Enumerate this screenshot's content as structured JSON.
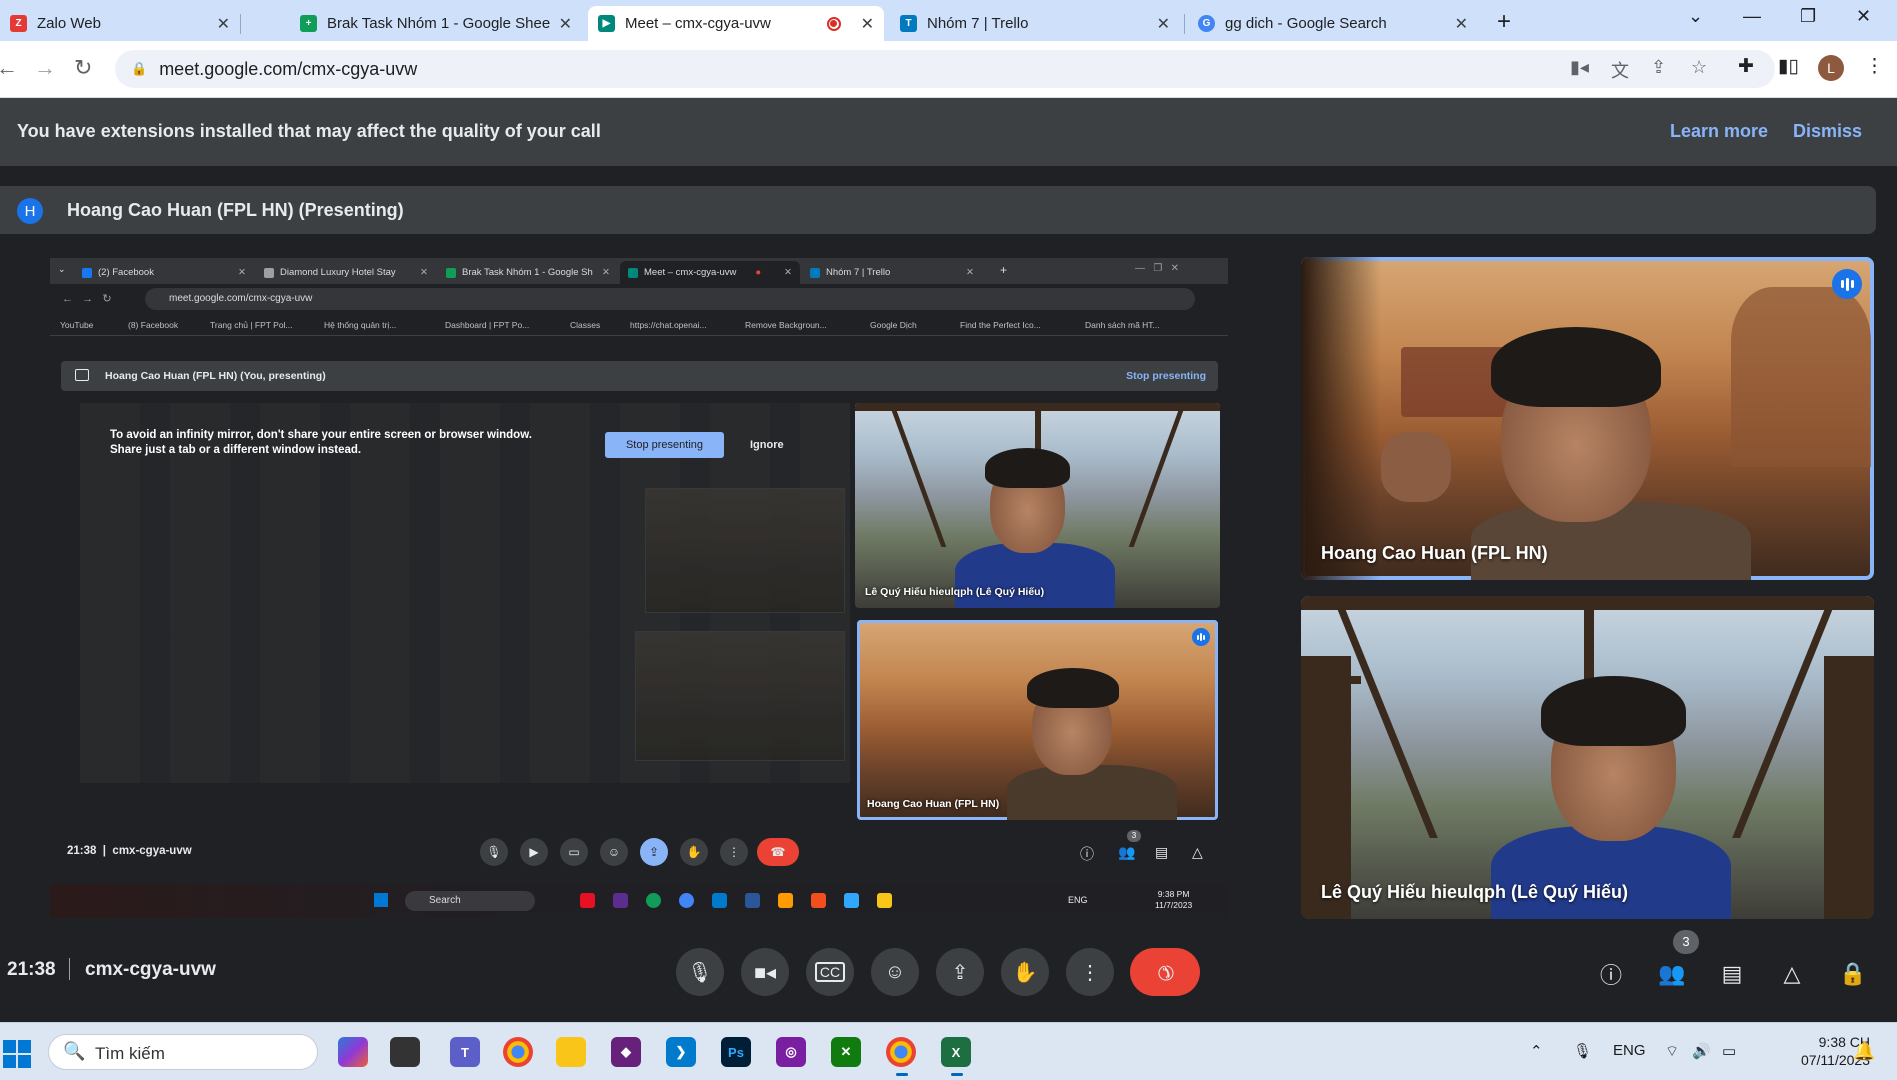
{
  "browser": {
    "tabs": [
      {
        "label": "Zalo Web",
        "favicon_color": "#e53935"
      },
      {
        "label": "Brak Task Nhóm 1 - Google Shee",
        "favicon_color": "#0f9d58"
      },
      {
        "label": "Meet – cmx-cgya-uvw",
        "favicon_color": "#00897b"
      },
      {
        "label": "Nhóm 7 | Trello",
        "favicon_color": "#0079bf"
      },
      {
        "label": "gg dich - Google Search",
        "favicon_color": "#4285f4"
      }
    ],
    "url": "meet.google.com/cmx-cgya-uvw",
    "profile_initial": "L"
  },
  "banner": {
    "message": "You have extensions installed that may affect the quality of your call",
    "learn_more": "Learn more",
    "dismiss": "Dismiss"
  },
  "presenting": {
    "avatar_initial": "H",
    "title": "Hoang Cao Huan (FPL HN) (Presenting)"
  },
  "shared_screen": {
    "tabs": [
      {
        "label": "(2) Facebook",
        "favicon_color": "#1877f2"
      },
      {
        "label": "Diamond Luxury Hotel Stay",
        "favicon_color": "#9aa0a6"
      },
      {
        "label": "Brak Task Nhóm 1 - Google Sh",
        "favicon_color": "#0f9d58"
      },
      {
        "label": "Meet – cmx-cgya-uvw",
        "favicon_color": "#00897b"
      },
      {
        "label": "Nhóm 7 | Trello",
        "favicon_color": "#0079bf"
      }
    ],
    "url": "meet.google.com/cmx-cgya-uvw",
    "bookmarks": [
      "YouTube",
      "(8) Facebook",
      "Trang chủ | FPT Pol...",
      "Hệ thống quản trị...",
      "Dashboard | FPT Po...",
      "Classes",
      "https://chat.openai...",
      "Remove Backgroun...",
      "Google Dịch",
      "Find the Perfect Ico...",
      "Danh sách mã HT..."
    ],
    "present_title": "Hoang Cao Huan (FPL HN) (You, presenting)",
    "stop_presenting_link": "Stop presenting",
    "warning": "To avoid an infinity mirror, don't share your entire screen or browser window. Share just a tab or a different window instead.",
    "stop_presenting_button": "Stop presenting",
    "ignore": "Ignore",
    "tile_top_name": "Lê Quý Hiếu hieulqph (Lê Quý Hiếu)",
    "tile_bottom_name": "Hoang Cao Huan (FPL HN)",
    "time": "21:38",
    "meeting_code": "cmx-cgya-uvw",
    "people_count": "3",
    "taskbar_search": "Search",
    "taskbar_lang": "ENG",
    "taskbar_time": "9:38 PM",
    "taskbar_date": "11/7/2023"
  },
  "participants": [
    {
      "name": "Hoang Cao Huan (FPL HN)",
      "speaking": true
    },
    {
      "name": "Lê Quý Hiếu hieulqph (Lê Quý Hiếu)",
      "speaking": false
    }
  ],
  "controls": {
    "time": "21:38",
    "meeting_code": "cmx-cgya-uvw",
    "people_count": "3"
  },
  "taskbar": {
    "search_placeholder": "Tìm kiếm",
    "lang": "ENG",
    "time": "9:38 CH",
    "date": "07/11/2023"
  },
  "colors": {
    "meet_bg": "#202124",
    "accent_blue": "#8ab4f8",
    "end_call_red": "#ea4335"
  }
}
